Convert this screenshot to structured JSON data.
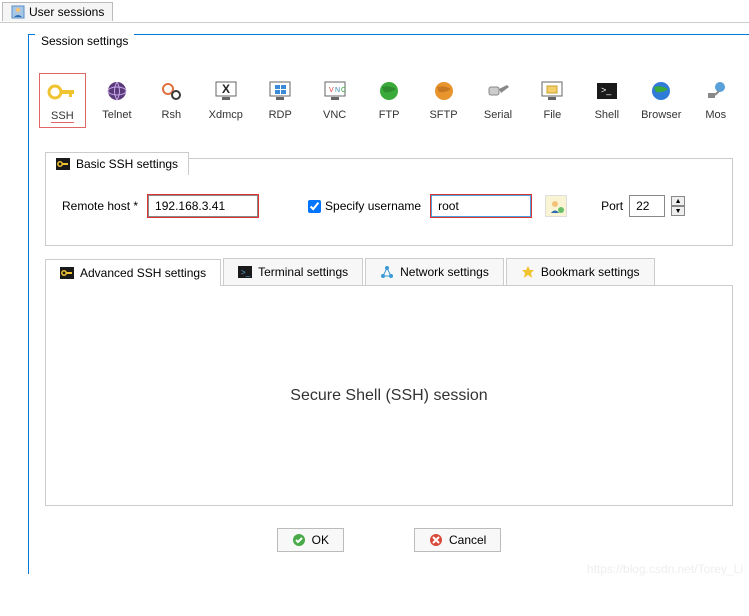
{
  "topTab": {
    "label": "User sessions"
  },
  "session": {
    "title": "Session settings"
  },
  "protocols": [
    {
      "id": "ssh",
      "label": "SSH",
      "selected": true
    },
    {
      "id": "telnet",
      "label": "Telnet"
    },
    {
      "id": "rsh",
      "label": "Rsh"
    },
    {
      "id": "xdmcp",
      "label": "Xdmcp"
    },
    {
      "id": "rdp",
      "label": "RDP"
    },
    {
      "id": "vnc",
      "label": "VNC"
    },
    {
      "id": "ftp",
      "label": "FTP"
    },
    {
      "id": "sftp",
      "label": "SFTP"
    },
    {
      "id": "serial",
      "label": "Serial"
    },
    {
      "id": "file",
      "label": "File"
    },
    {
      "id": "shell",
      "label": "Shell"
    },
    {
      "id": "browser",
      "label": "Browser"
    },
    {
      "id": "mosh",
      "label": "Mos"
    }
  ],
  "basic": {
    "groupTitle": "Basic SSH settings",
    "remoteHostLabel": "Remote host *",
    "remoteHost": "192.168.3.41",
    "specifyUsernameLabel": "Specify username",
    "specifyUsernameChecked": true,
    "username": "root",
    "portLabel": "Port",
    "port": "22"
  },
  "tabs": [
    {
      "id": "adv",
      "label": "Advanced SSH settings"
    },
    {
      "id": "term",
      "label": "Terminal settings"
    },
    {
      "id": "net",
      "label": "Network settings"
    },
    {
      "id": "book",
      "label": "Bookmark settings"
    }
  ],
  "content": {
    "message": "Secure Shell (SSH) session"
  },
  "buttons": {
    "ok": "OK",
    "cancel": "Cancel"
  },
  "watermark": "https://blog.csdn.net/Torey_Li"
}
